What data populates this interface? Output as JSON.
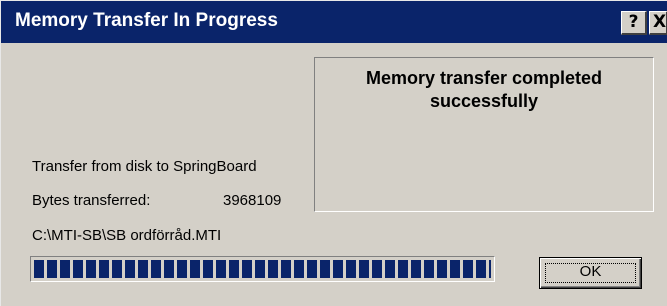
{
  "window": {
    "title": "Memory Transfer In Progress",
    "help_label": "?",
    "close_label": "X",
    "colors": {
      "title_bar": "#0a246a",
      "face": "#d4d0c8",
      "progress_block": "#0a246a"
    }
  },
  "status": {
    "message": "Memory transfer completed successfully"
  },
  "transfer": {
    "direction": "Transfer from disk to SpringBoard",
    "bytes_label": "Bytes transferred:",
    "bytes_value": "3968109",
    "file_path": "C:\\MTI-SB\\SB ordförråd.MTI"
  },
  "progress": {
    "percent": 100
  },
  "buttons": {
    "ok_label": "OK"
  }
}
